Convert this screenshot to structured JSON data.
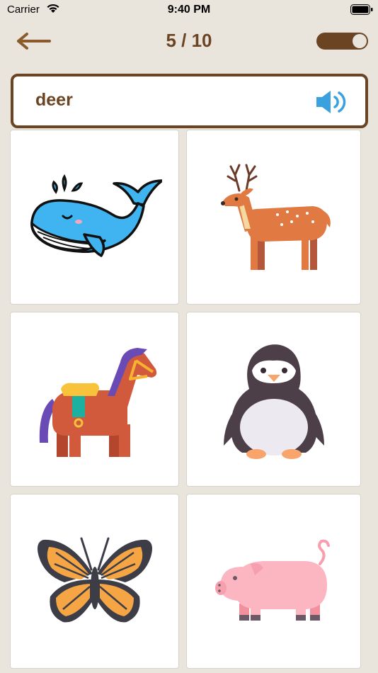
{
  "status_bar": {
    "carrier": "Carrier",
    "time": "9:40 PM"
  },
  "header": {
    "progress": "5 / 10",
    "back_icon": "arrow-left-icon",
    "toggle_state": "on"
  },
  "prompt": {
    "word": "deer",
    "speaker_icon": "speaker-icon"
  },
  "choices": [
    {
      "animal": "whale"
    },
    {
      "animal": "deer"
    },
    {
      "animal": "horse"
    },
    {
      "animal": "penguin"
    },
    {
      "animal": "butterfly"
    },
    {
      "animal": "pig"
    }
  ],
  "colors": {
    "background": "#e9e4dc",
    "accent_brown": "#6b4423",
    "speaker_blue": "#3aa0e0"
  }
}
